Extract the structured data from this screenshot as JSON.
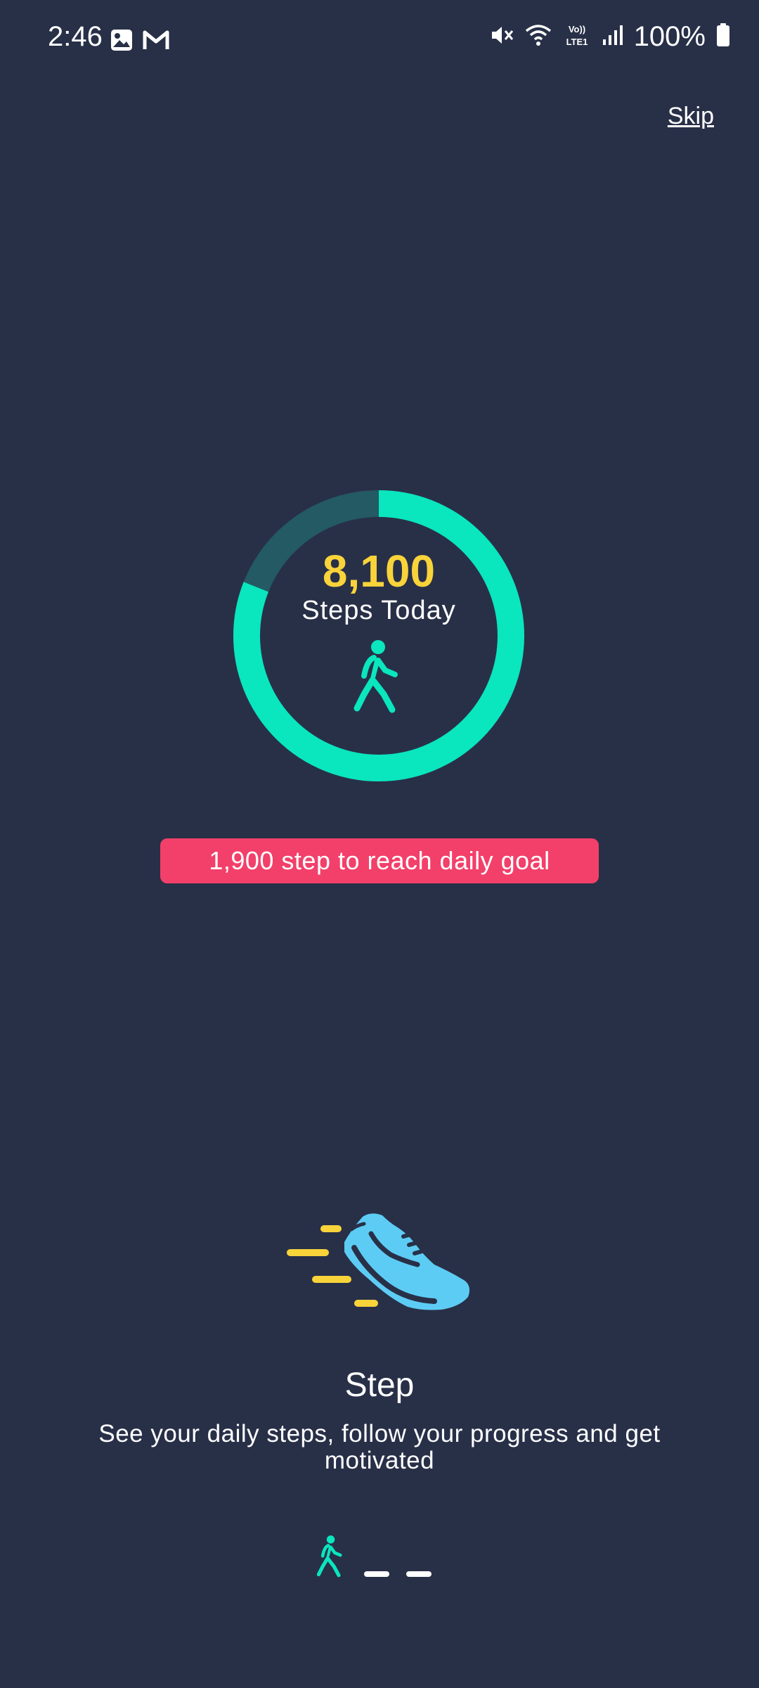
{
  "status_bar": {
    "time": "2:46",
    "battery": "100%",
    "icons": [
      "image-icon",
      "gmail-icon",
      "mute-icon",
      "wifi-icon",
      "volte-icon",
      "signal-icon",
      "battery-icon"
    ]
  },
  "header": {
    "skip_label": "Skip"
  },
  "progress": {
    "steps_value": "8,100",
    "steps_label": "Steps Today",
    "fraction": 0.81,
    "goal_message": "1,900 step to reach daily goal"
  },
  "feature": {
    "title": "Step",
    "description": "See your daily steps, follow your progress and get motivated"
  },
  "pager": {
    "pages": 3,
    "current": 1
  },
  "colors": {
    "background": "#283048",
    "ring_track": "#235A63",
    "ring_fill": "#0AE6BE",
    "steps_value": "#F9D33A",
    "badge": "#F2406A",
    "shoe": "#5DCCF5",
    "speed_lines": "#F9D33A"
  }
}
